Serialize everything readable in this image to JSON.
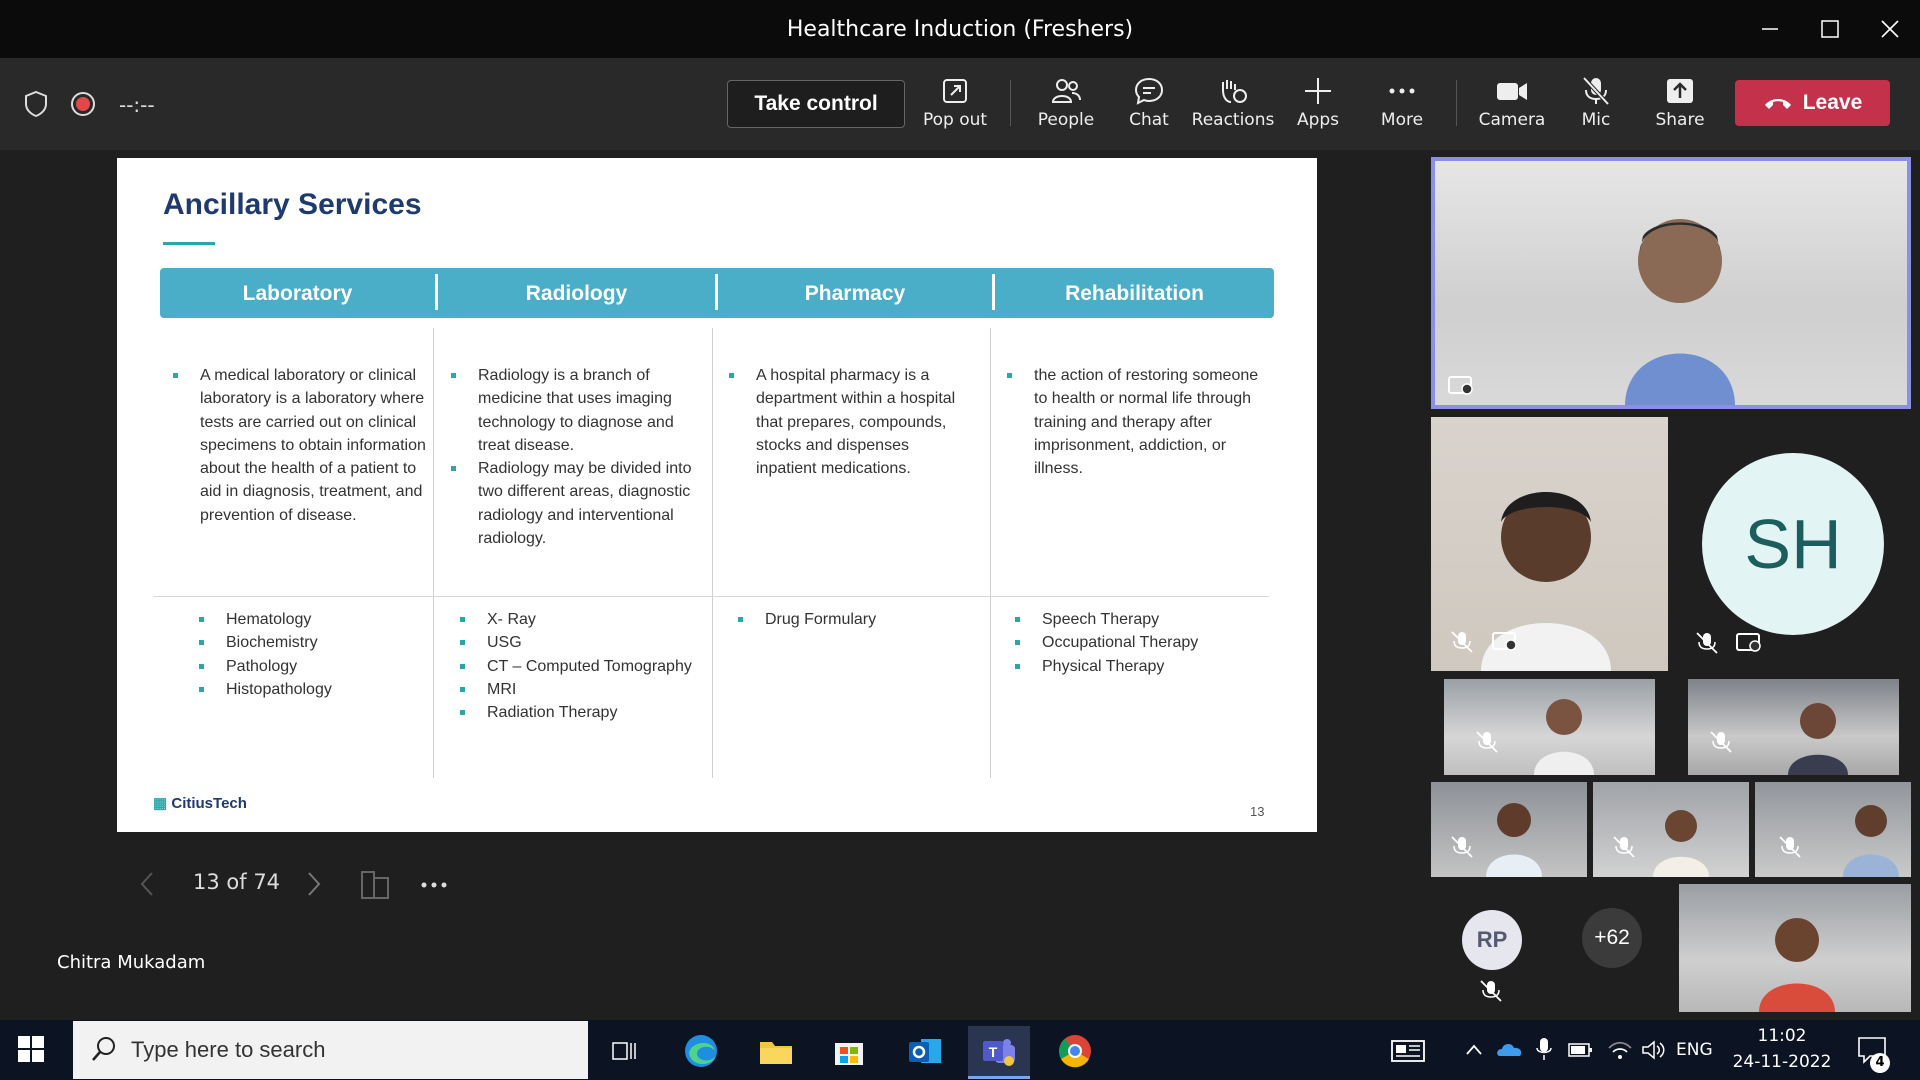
{
  "window": {
    "title": "Healthcare Induction (Freshers)"
  },
  "toolbar": {
    "timer": "--:--",
    "take_control": "Take control",
    "items": [
      {
        "label": "Pop out",
        "icon": "popout-icon"
      },
      {
        "label": "People",
        "icon": "people-icon"
      },
      {
        "label": "Chat",
        "icon": "chat-icon"
      },
      {
        "label": "Reactions",
        "icon": "reactions-icon"
      },
      {
        "label": "Apps",
        "icon": "plus-icon"
      },
      {
        "label": "More",
        "icon": "more-icon"
      },
      {
        "label": "Camera",
        "icon": "camera-icon"
      },
      {
        "label": "Mic",
        "icon": "mic-off-icon"
      },
      {
        "label": "Share",
        "icon": "share-icon"
      }
    ],
    "leave": "Leave"
  },
  "slide": {
    "title": "Ancillary Services",
    "headers": [
      "Laboratory",
      "Radiology",
      "Pharmacy",
      "Rehabilitation"
    ],
    "lab_desc": "A medical laboratory or clinical laboratory is a laboratory where tests are carried out on clinical specimens to obtain information about the health of a patient to aid in diagnosis, treatment, and prevention of disease.",
    "rad_desc_1": "Radiology is a branch of medicine that uses imaging technology to diagnose and treat disease.",
    "rad_desc_2": " Radiology may be divided into two different areas, diagnostic radiology and interventional radiology.",
    "pharm_desc": "A hospital pharmacy is a department within a hospital that prepares, compounds, stocks and dispenses inpatient medications.",
    "rehab_desc": "the action of restoring someone to health or normal life through training and therapy after imprisonment, addiction, or illness.",
    "lab_items": [
      "Hematology",
      "Biochemistry",
      "Pathology",
      "Histopathology"
    ],
    "rad_items": [
      "X- Ray",
      "USG",
      "CT – Computed Tomography",
      "MRI",
      "Radiation Therapy"
    ],
    "pharm_items": [
      "Drug Formulary"
    ],
    "rehab_items": [
      "Speech Therapy",
      "Occupational Therapy",
      "Physical Therapy"
    ],
    "logo": "CitiusTech",
    "page_number": "13"
  },
  "slide_nav": {
    "count": "13 of 74"
  },
  "presenter": {
    "name": "Chitra Mukadam"
  },
  "participants": {
    "sh_initials": "SH",
    "rp_initials": "RP",
    "more_count": "+62"
  },
  "taskbar": {
    "search_placeholder": "Type here to search",
    "language": "ENG",
    "time": "11:02",
    "date": "24-11-2022",
    "notification_count": "4"
  },
  "colors": {
    "leave": "#c4314b",
    "slide_header": "#4aaec9",
    "accent": "#2aa7a9",
    "title": "#1f3a6e"
  }
}
